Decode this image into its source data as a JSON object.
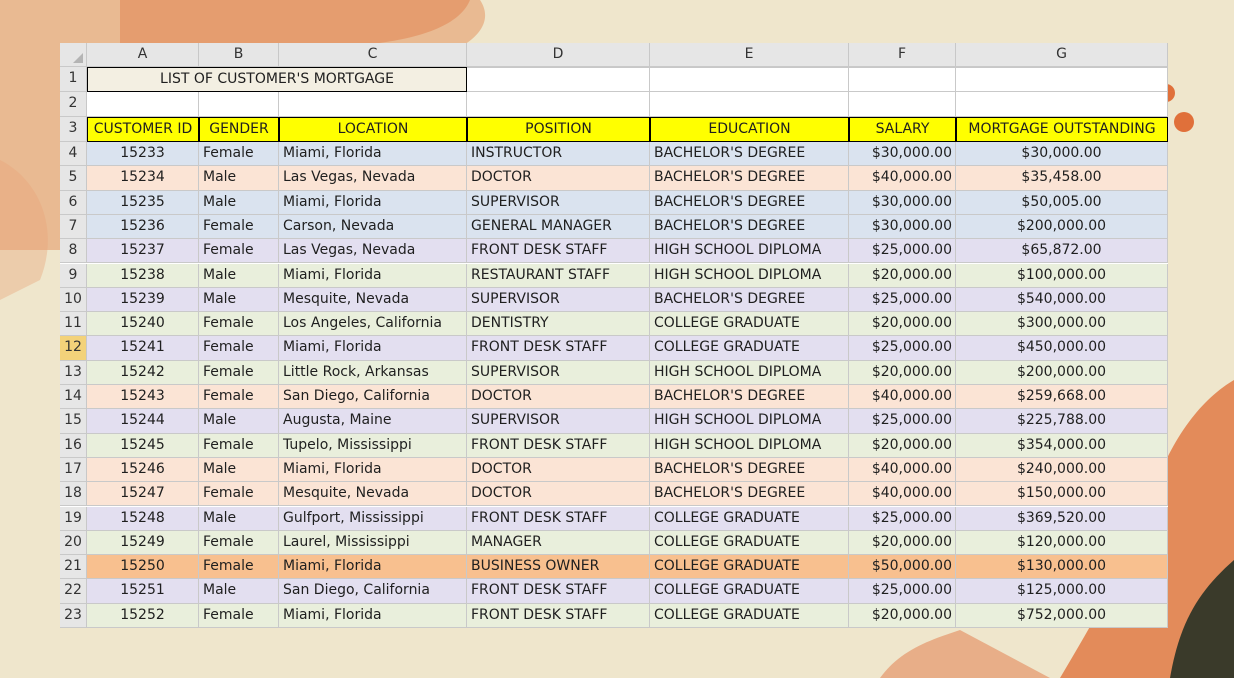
{
  "sheet": {
    "columns": [
      "A",
      "B",
      "C",
      "D",
      "E",
      "F",
      "G"
    ],
    "title": "LIST OF CUSTOMER'S MORTGAGE",
    "headers": [
      "CUSTOMER ID",
      "GENDER",
      "LOCATION",
      "POSITION",
      "EDUCATION",
      "SALARY",
      "MORTGAGE OUTSTANDING"
    ],
    "row_numbers": [
      "1",
      "2",
      "3",
      "4",
      "5",
      "6",
      "7",
      "8",
      "9",
      "10",
      "11",
      "12",
      "13",
      "14",
      "15",
      "16",
      "17",
      "18",
      "19",
      "20",
      "21",
      "22",
      "23"
    ],
    "selected_row": "12",
    "colors": {
      "header_fill": "#ffff00",
      "blue": "#dae3ef",
      "peach": "#fbe4d5",
      "lavender": "#e3dff0",
      "green": "#e9efdc",
      "orange": "#f8c08f"
    },
    "rows": [
      {
        "id": "15233",
        "gender": "Female",
        "location": "Miami, Florida",
        "position": "INSTRUCTOR",
        "education": "BACHELOR'S DEGREE",
        "salary": "$30,000.00",
        "mortgage": "$30,000.00",
        "color": "#dae3ef"
      },
      {
        "id": "15234",
        "gender": "Male",
        "location": "Las Vegas, Nevada",
        "position": "DOCTOR",
        "education": "BACHELOR'S DEGREE",
        "salary": "$40,000.00",
        "mortgage": "$35,458.00",
        "color": "#fbe4d5"
      },
      {
        "id": "15235",
        "gender": "Male",
        "location": "Miami, Florida",
        "position": "SUPERVISOR",
        "education": "BACHELOR'S DEGREE",
        "salary": "$30,000.00",
        "mortgage": "$50,005.00",
        "color": "#dae3ef"
      },
      {
        "id": "15236",
        "gender": "Female",
        "location": "Carson, Nevada",
        "position": "GENERAL MANAGER",
        "education": "BACHELOR'S DEGREE",
        "salary": "$30,000.00",
        "mortgage": "$200,000.00",
        "color": "#dae3ef"
      },
      {
        "id": "15237",
        "gender": "Female",
        "location": "Las Vegas, Nevada",
        "position": "FRONT DESK STAFF",
        "education": "HIGH SCHOOL DIPLOMA",
        "salary": "$25,000.00",
        "mortgage": "$65,872.00",
        "color": "#e3dff0"
      },
      {
        "id": "15238",
        "gender": "Male",
        "location": "Miami, Florida",
        "position": "RESTAURANT STAFF",
        "education": "HIGH SCHOOL DIPLOMA",
        "salary": "$20,000.00",
        "mortgage": "$100,000.00",
        "color": "#e9efdc"
      },
      {
        "id": "15239",
        "gender": "Male",
        "location": "Mesquite, Nevada",
        "position": "SUPERVISOR",
        "education": "BACHELOR'S DEGREE",
        "salary": "$25,000.00",
        "mortgage": "$540,000.00",
        "color": "#e3dff0"
      },
      {
        "id": "15240",
        "gender": "Female",
        "location": "Los Angeles, California",
        "position": "DENTISTRY",
        "education": "COLLEGE GRADUATE",
        "salary": "$20,000.00",
        "mortgage": "$300,000.00",
        "color": "#e9efdc"
      },
      {
        "id": "15241",
        "gender": "Female",
        "location": "Miami, Florida",
        "position": "FRONT DESK STAFF",
        "education": "COLLEGE GRADUATE",
        "salary": "$25,000.00",
        "mortgage": "$450,000.00",
        "color": "#e3dff0"
      },
      {
        "id": "15242",
        "gender": "Female",
        "location": "Little Rock, Arkansas",
        "position": "SUPERVISOR",
        "education": "HIGH SCHOOL DIPLOMA",
        "salary": "$20,000.00",
        "mortgage": "$200,000.00",
        "color": "#e9efdc"
      },
      {
        "id": "15243",
        "gender": "Female",
        "location": "San Diego, California",
        "position": "DOCTOR",
        "education": "BACHELOR'S DEGREE",
        "salary": "$40,000.00",
        "mortgage": "$259,668.00",
        "color": "#fbe4d5"
      },
      {
        "id": "15244",
        "gender": "Male",
        "location": "Augusta, Maine",
        "position": "SUPERVISOR",
        "education": "HIGH SCHOOL DIPLOMA",
        "salary": "$25,000.00",
        "mortgage": "$225,788.00",
        "color": "#e3dff0"
      },
      {
        "id": "15245",
        "gender": "Female",
        "location": "Tupelo, Mississippi",
        "position": "FRONT DESK STAFF",
        "education": "HIGH SCHOOL DIPLOMA",
        "salary": "$20,000.00",
        "mortgage": "$354,000.00",
        "color": "#e9efdc"
      },
      {
        "id": "15246",
        "gender": "Male",
        "location": "Miami, Florida",
        "position": "DOCTOR",
        "education": "BACHELOR'S DEGREE",
        "salary": "$40,000.00",
        "mortgage": "$240,000.00",
        "color": "#fbe4d5"
      },
      {
        "id": "15247",
        "gender": "Female",
        "location": "Mesquite, Nevada",
        "position": "DOCTOR",
        "education": "BACHELOR'S DEGREE",
        "salary": "$40,000.00",
        "mortgage": "$150,000.00",
        "color": "#fbe4d5"
      },
      {
        "id": "15248",
        "gender": "Male",
        "location": "Gulfport, Mississippi",
        "position": "FRONT DESK STAFF",
        "education": "COLLEGE GRADUATE",
        "salary": "$25,000.00",
        "mortgage": "$369,520.00",
        "color": "#e3dff0"
      },
      {
        "id": "15249",
        "gender": "Female",
        "location": "Laurel, Mississippi",
        "position": "MANAGER",
        "education": "COLLEGE GRADUATE",
        "salary": "$20,000.00",
        "mortgage": "$120,000.00",
        "color": "#e9efdc"
      },
      {
        "id": "15250",
        "gender": "Female",
        "location": "Miami, Florida",
        "position": "BUSINESS OWNER",
        "education": "COLLEGE GRADUATE",
        "salary": "$50,000.00",
        "mortgage": "$130,000.00",
        "color": "#f8c08f"
      },
      {
        "id": "15251",
        "gender": "Male",
        "location": "San Diego, California",
        "position": "FRONT DESK STAFF",
        "education": "COLLEGE GRADUATE",
        "salary": "$25,000.00",
        "mortgage": "$125,000.00",
        "color": "#e3dff0"
      },
      {
        "id": "15252",
        "gender": "Female",
        "location": "Miami, Florida",
        "position": "FRONT DESK STAFF",
        "education": "COLLEGE GRADUATE",
        "salary": "$20,000.00",
        "mortgage": "$752,000.00",
        "color": "#e9efdc"
      }
    ]
  }
}
